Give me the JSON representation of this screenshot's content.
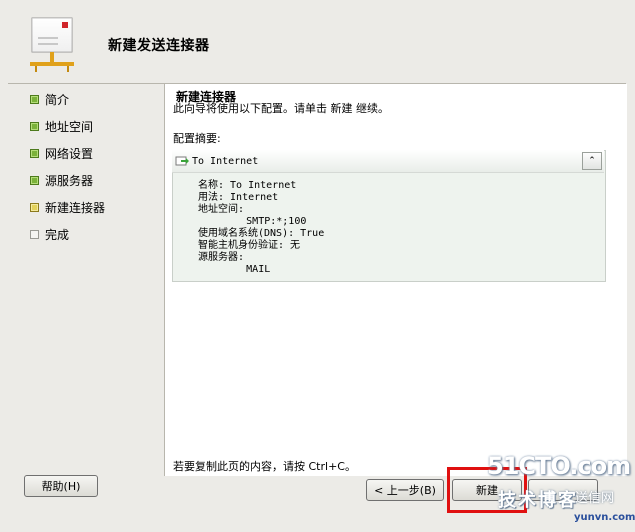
{
  "header": {
    "title": "新建发送连接器",
    "icon": "mail-connector-icon"
  },
  "nav": {
    "items": [
      {
        "label": "简介",
        "state": "done"
      },
      {
        "label": "地址空间",
        "state": "done"
      },
      {
        "label": "网络设置",
        "state": "done"
      },
      {
        "label": "源服务器",
        "state": "done"
      },
      {
        "label": "新建连接器",
        "state": "current"
      },
      {
        "label": "完成",
        "state": "todo"
      }
    ]
  },
  "main": {
    "heading": "新建连接器",
    "description": "此向导将使用以下配置。请单击 新建 继续。",
    "summary_label": "配置摘要:",
    "summary": {
      "title": "To Internet",
      "collapse_glyph": "⌃",
      "lines": [
        "名称: To Internet",
        "用法: Internet",
        "地址空间:",
        "        SMTP:*;100",
        "使用域名系统(DNS): True",
        "智能主机身份验证: 无",
        "源服务器:",
        "        MAIL"
      ]
    },
    "copy_hint": "若要复制此页的内容，请按 Ctrl+C。"
  },
  "buttons": {
    "help": "帮助(H)",
    "back": "< 上一步(B)",
    "next": "新建",
    "cancel": ""
  },
  "watermark": {
    "line1": "51CTO.com",
    "line2": "技术博客",
    "line3": "送信网",
    "line4": "yunvn.com"
  }
}
